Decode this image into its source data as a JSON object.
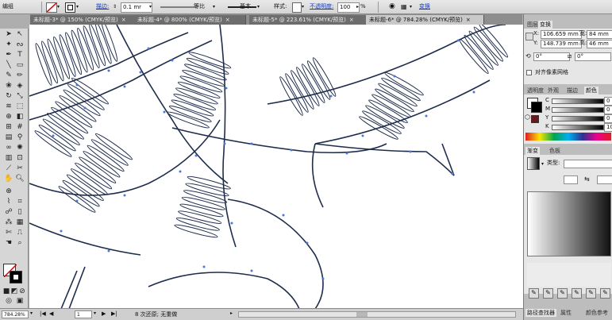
{
  "control_bar": {
    "mode_label": "编组",
    "stroke_label": "描边:",
    "stroke_weight": "0.1 mr",
    "profile_label": "等比",
    "brush_label": "基本",
    "style_label": "样式:",
    "opacity_label": "不透明度:",
    "opacity_value": "100",
    "percent_sign": "%",
    "transform_link": "变换"
  },
  "tabs": [
    {
      "label": "未标题-3* @ 150% (CMYK/预览)",
      "close": "×"
    },
    {
      "label": "未标题-4* @ 800% (CMYK/预览)",
      "close": "×"
    },
    {
      "label": "未标题-5* @ 223.61% (CMYK/预览)",
      "close": "×"
    },
    {
      "label": "未标题-6* @ 784.28% (CMYK/预览)",
      "close": "×"
    }
  ],
  "status_bar": {
    "zoom": "784.28%",
    "artboard": "1",
    "history": "8 次还原; 无重做"
  },
  "panels": {
    "layers_tab": "图层",
    "transform_tab": "变换",
    "x_label": "X:",
    "x_value": "106.659 mm",
    "y_label": "Y:",
    "y_value": "148.739 mm",
    "w_label": "宽:",
    "w_value": "84 mm",
    "h_label": "高:",
    "h_value": "46 mm",
    "angle_1": "0°",
    "angle_2": "0°",
    "align_pixel": "对齐像素网格",
    "color_tabs": [
      "透明度",
      "外观",
      "描边",
      "颜色"
    ],
    "cmyk_labels": [
      "C",
      "M",
      "Y",
      "K"
    ],
    "cmyk_values": [
      "0",
      "0",
      "0",
      "100"
    ],
    "gradient_tabs": [
      "渐变",
      "色板"
    ],
    "type_label": "类型:",
    "bottom_tabs": [
      "路径查找器",
      "属性",
      "颜色参考"
    ]
  },
  "colors": {
    "path_stroke": "#1f2d4d",
    "anchor": "#4a78d6",
    "accent_link": "#1a3bb8"
  }
}
